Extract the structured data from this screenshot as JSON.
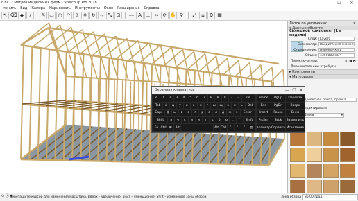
{
  "window": {
    "title": "с 8х12 метров из двойных ферм - SketchUp Pro 2018",
    "minimize": "—",
    "maximize": "☐",
    "close": "✕"
  },
  "menu": [
    "менить",
    "Вид",
    "Камера",
    "Нарисовать",
    "Инструменты",
    "Окно",
    "Расширения",
    "Справка"
  ],
  "toolbar": {
    "icons": [
      "select-icon",
      "eraser-icon",
      "paint-bucket-icon",
      "line-icon",
      "freehand-icon",
      "rectangle-icon",
      "circle-icon",
      "arc-icon",
      "push-pull-icon",
      "move-icon",
      "rotate-icon",
      "follow-me-icon",
      "scale-icon",
      "offset-icon",
      "tape-icon",
      "text-icon",
      "axes-icon",
      "dimension-icon",
      "orbit-icon",
      "pan-icon",
      "zoom-icon",
      "zoom-extents-icon",
      "warehouse-icon",
      "extension-icon",
      "layout-icon"
    ],
    "glyphs": [
      "↖",
      "⌫",
      "◆",
      "/",
      "✎",
      "▭",
      "○",
      "◠",
      "⇧",
      "✥",
      "↻",
      "⤳",
      "⤡",
      "⊡",
      "⊷",
      "A",
      "⊥",
      "↔",
      "⟳",
      "✋",
      "⚲",
      "⤢",
      "⌂",
      "⚙",
      "▦"
    ]
  },
  "tray": {
    "title": "Лоток по умолчанию",
    "close": "✕",
    "entity_info": {
      "section": "Данные объекта",
      "heading": "Сплошной компонент (1 в модели)",
      "rows": [
        {
          "label": "Слой:",
          "value": "Layer0"
        },
        {
          "label": "Экземпляр:",
          "value": "Введите имя экземп"
        },
        {
          "label": "Определение:",
          "value": "Перемычка 1"
        },
        {
          "label": "Объем:",
          "value": "4350000 мм³"
        }
      ],
      "toggle_label": "Переключатели:",
      "extra_section": "Дополнительные атрибуты"
    },
    "components_section": "Компоненты",
    "materials_section": "Материалы",
    "material": {
      "name": "Древесная плита, пробка",
      "edit_tab": "Редактировать",
      "category": "Дерев"
    },
    "swatch_colors": [
      "#b9793a",
      "#dcb77f",
      "#c48a3e",
      "#8b5a2b",
      "#d9a650",
      "#efcf9a",
      "#c9934a",
      "#a0632e",
      "#e2b870",
      "#b4855a",
      "#d3a462",
      "#c08040",
      "#a87040",
      "#deb887",
      "#cfa16a",
      "#9a6a3a"
    ]
  },
  "keyboard": {
    "title": "Экранная клавиатура",
    "minimize": "—",
    "maximize": "☐",
    "close": "✕",
    "rows": [
      [
        {
          "name": "key-tilde",
          "label": "ё"
        },
        {
          "name": "key-1",
          "label": "1"
        },
        {
          "name": "key-2",
          "label": "2"
        },
        {
          "name": "key-3",
          "label": "3"
        },
        {
          "name": "key-4",
          "label": "4"
        },
        {
          "name": "key-5",
          "label": "5"
        },
        {
          "name": "key-6",
          "label": "6"
        },
        {
          "name": "key-7",
          "label": "7"
        },
        {
          "name": "key-8",
          "label": "8"
        },
        {
          "name": "key-9",
          "label": "9"
        },
        {
          "name": "key-0",
          "label": "0"
        },
        {
          "name": "key-minus",
          "label": "-"
        },
        {
          "name": "key-equal",
          "label": "="
        },
        {
          "name": "key-backspace",
          "label": "⌫"
        }
      ],
      [
        {
          "name": "key-tab",
          "label": "Tab"
        },
        {
          "name": "key-q",
          "label": "й"
        },
        {
          "name": "key-w",
          "label": "ц"
        },
        {
          "name": "key-e",
          "label": "у"
        },
        {
          "name": "key-r",
          "label": "к"
        },
        {
          "name": "key-t",
          "label": "е"
        },
        {
          "name": "key-y",
          "label": "н"
        },
        {
          "name": "key-u",
          "label": "г"
        },
        {
          "name": "key-i",
          "label": "ш"
        },
        {
          "name": "key-o",
          "label": "щ"
        },
        {
          "name": "key-p",
          "label": "з"
        },
        {
          "name": "key-bracket-l",
          "label": "х"
        },
        {
          "name": "key-bracket-r",
          "label": "ъ"
        },
        {
          "name": "key-del",
          "label": "Del"
        }
      ],
      [
        {
          "name": "key-caps",
          "label": "Caps"
        },
        {
          "name": "key-a",
          "label": "ф"
        },
        {
          "name": "key-s",
          "label": "ы"
        },
        {
          "name": "key-d",
          "label": "в"
        },
        {
          "name": "key-f",
          "label": "а"
        },
        {
          "name": "key-g",
          "label": "п"
        },
        {
          "name": "key-h",
          "label": "р"
        },
        {
          "name": "key-j",
          "label": "о"
        },
        {
          "name": "key-k",
          "label": "л"
        },
        {
          "name": "key-l",
          "label": "д"
        },
        {
          "name": "key-semicolon",
          "label": "ж"
        },
        {
          "name": "key-quote",
          "label": "э"
        },
        {
          "name": "key-enter",
          "label": "Enter"
        }
      ],
      [
        {
          "name": "key-shift-left",
          "label": "Shift"
        },
        {
          "name": "key-z",
          "label": "я"
        },
        {
          "name": "key-x",
          "label": "ч"
        },
        {
          "name": "key-c",
          "label": "с"
        },
        {
          "name": "key-v",
          "label": "м"
        },
        {
          "name": "key-b",
          "label": "и"
        },
        {
          "name": "key-n",
          "label": "т"
        },
        {
          "name": "key-m",
          "label": "ь"
        },
        {
          "name": "key-comma",
          "label": "б"
        },
        {
          "name": "key-period",
          "label": "ю"
        },
        {
          "name": "key-slash",
          "label": "."
        },
        {
          "name": "key-up",
          "label": "˄"
        },
        {
          "name": "key-shift-right",
          "label": "Shift"
        }
      ],
      [
        {
          "name": "key-fn",
          "label": "Fn"
        },
        {
          "name": "key-ctrl-left",
          "label": "Ctrl"
        },
        {
          "name": "key-win",
          "label": "⊞"
        },
        {
          "name": "key-alt-left",
          "label": "Alt"
        },
        {
          "name": "key-space",
          "label": ""
        },
        {
          "name": "key-alt-right",
          "label": "Alt"
        },
        {
          "name": "key-ctrl-right",
          "label": "Ctrl"
        },
        {
          "name": "key-left",
          "label": "˂"
        },
        {
          "name": "key-down",
          "label": "˅"
        },
        {
          "name": "key-right",
          "label": "˃"
        },
        {
          "name": "key-menu",
          "label": "▤"
        }
      ]
    ],
    "nav": [
      [
        {
          "name": "key-home",
          "label": "Home"
        },
        {
          "name": "key-pgup",
          "label": "PgUp"
        },
        {
          "name": "key-navigate",
          "label": "Перейти"
        }
      ],
      [
        {
          "name": "key-end",
          "label": "End"
        },
        {
          "name": "key-pgdn",
          "label": "PgDn"
        },
        {
          "name": "key-up-alt",
          "label": "Вверх"
        }
      ],
      [
        {
          "name": "key-insert",
          "label": "Insert"
        },
        {
          "name": "key-pause",
          "label": "Pause"
        },
        {
          "name": "key-down-alt",
          "label": "Вниз"
        }
      ],
      [
        {
          "name": "key-prtscn",
          "label": "PrtScn"
        },
        {
          "name": "key-scrlk",
          "label": "ScLk"
        },
        {
          "name": "key-dock",
          "label": "Закрепить"
        }
      ],
      [
        {
          "name": "key-options",
          "label": "Параметры"
        },
        {
          "name": "key-help",
          "label": "Справка"
        },
        {
          "name": "key-fade",
          "label": "Исчезание"
        }
      ]
    ]
  },
  "status": {
    "text": "Перетащите курсор для изменения масштаба. Вверх – увеличение, вниз – уменьшение. Shift – изменение зоны обзора.",
    "label": "Зона обзора",
    "value": "35.00 град"
  }
}
